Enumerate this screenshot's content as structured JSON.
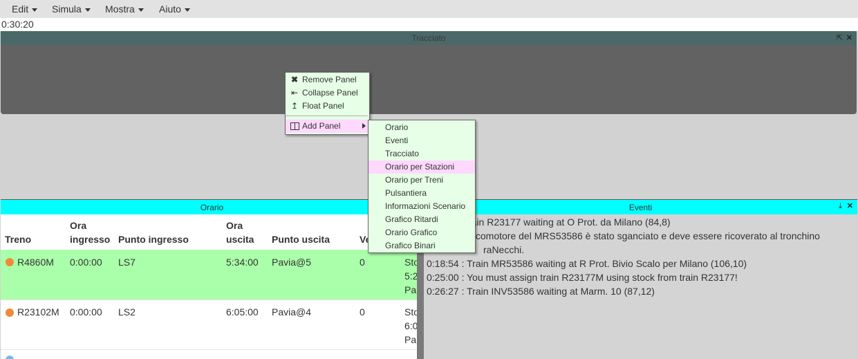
{
  "menubar": {
    "items": [
      "Edit",
      "Simula",
      "Mostra",
      "Aiuto"
    ]
  },
  "clock": "0:30:20",
  "tracciato": {
    "title": "Tracciato"
  },
  "orario": {
    "title": "Orario",
    "headers": {
      "treno": "Treno",
      "ora_ingresso_1": "Ora",
      "ora_ingresso_2": "ingresso",
      "punto_ingresso": "Punto ingresso",
      "ora_uscita_1": "Ora",
      "ora_uscita_2": "uscita",
      "punto_uscita": "Punto uscita",
      "ve": "Ve"
    },
    "rows": [
      {
        "treno": "R4860M",
        "ingresso": "0:00:00",
        "punto_ingresso": "LS7",
        "uscita": "5:34:00",
        "punto_uscita": "Pavia@5",
        "ve": "0",
        "extra1": "Sto",
        "extra2": "5:2",
        "extra3": "Pa",
        "dot_color": "#f08a3a",
        "bg": "#aaffaa"
      },
      {
        "treno": "R23102M",
        "ingresso": "0:00:00",
        "punto_ingresso": "LS2",
        "uscita": "6:05:00",
        "punto_uscita": "Pavia@4",
        "ve": "0",
        "extra1": "Sto",
        "extra2": "6:0",
        "extra3": "Pa",
        "dot_color": "#f08a3a",
        "bg": "#ffffff"
      }
    ]
  },
  "eventi": {
    "title": "Eventi",
    "lines": [
      "rain R23177 waiting at O Prot. da Milano (84,8)",
      "locomotore del MRS53586 è stato sganciato e deve essere ricoverato al tronchino",
      "raNecchi.",
      "0:18:54 : Train MR53586 waiting at R Prot. Bivio Scalo per Milano (106,10)",
      "0:25:00 : You must assign train R23177M using stock from train R23177!",
      "0:26:27 : Train INV53586 waiting at Marm. 10 (87,12)"
    ]
  },
  "context_menu": {
    "items": [
      {
        "label": "Remove Panel",
        "icon": "close-icon"
      },
      {
        "label": "Collapse Panel",
        "icon": "collapse-icon"
      },
      {
        "label": "Float Panel",
        "icon": "float-icon"
      },
      {
        "label": "Add Panel",
        "icon": "panel-icon"
      }
    ]
  },
  "submenu": {
    "items": [
      "Orario",
      "Eventi",
      "Tracciato",
      "Orario per Stazioni",
      "Orario per Treni",
      "Pulsantiera",
      "Informazioni Scenario",
      "Grafico Ritardi",
      "Orario Grafico",
      "Grafico Binari"
    ],
    "highlighted": "Orario per Stazioni"
  }
}
